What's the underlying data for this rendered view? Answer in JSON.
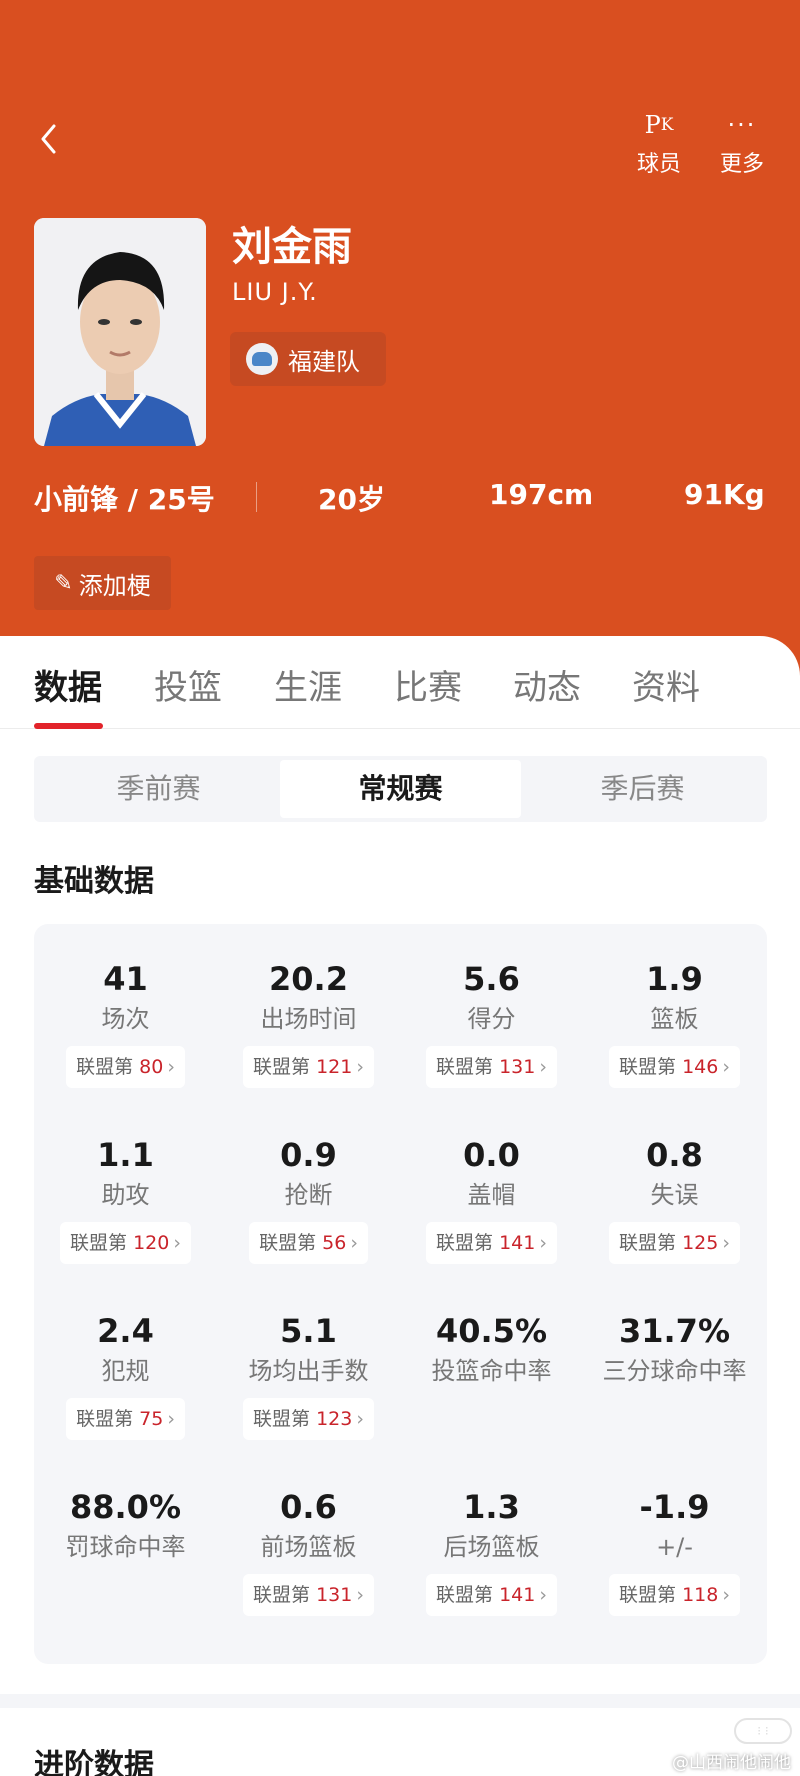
{
  "header": {
    "pk_label": "球员",
    "more_label": "更多",
    "player_name": "刘金雨",
    "player_name_en": "LIU J.Y.",
    "team": "福建队",
    "position_number": "小前锋 / 25号",
    "age": "20岁",
    "height": "197cm",
    "weight": "91Kg",
    "add_tag_label": "添加梗",
    "background_color": "#d94f20"
  },
  "tabs": [
    {
      "label": "数据",
      "active": true
    },
    {
      "label": "投篮",
      "active": false
    },
    {
      "label": "生涯",
      "active": false
    },
    {
      "label": "比赛",
      "active": false
    },
    {
      "label": "动态",
      "active": false
    },
    {
      "label": "资料",
      "active": false
    }
  ],
  "season_types": [
    {
      "label": "季前赛",
      "active": false
    },
    {
      "label": "常规赛",
      "active": true
    },
    {
      "label": "季后赛",
      "active": false
    }
  ],
  "basic_title": "基础数据",
  "advanced_title": "进阶数据",
  "rank_prefix": "联盟第",
  "basic_stats": [
    {
      "value": "41",
      "label": "场次",
      "rank": "80"
    },
    {
      "value": "20.2",
      "label": "出场时间",
      "rank": "121"
    },
    {
      "value": "5.6",
      "label": "得分",
      "rank": "131"
    },
    {
      "value": "1.9",
      "label": "篮板",
      "rank": "146"
    },
    {
      "value": "1.1",
      "label": "助攻",
      "rank": "120"
    },
    {
      "value": "0.9",
      "label": "抢断",
      "rank": "56"
    },
    {
      "value": "0.0",
      "label": "盖帽",
      "rank": "141"
    },
    {
      "value": "0.8",
      "label": "失误",
      "rank": "125"
    },
    {
      "value": "2.4",
      "label": "犯规",
      "rank": "75"
    },
    {
      "value": "5.1",
      "label": "场均出手数",
      "rank": "123"
    },
    {
      "value": "40.5%",
      "label": "投篮命中率",
      "rank": null
    },
    {
      "value": "31.7%",
      "label": "三分球命中率",
      "rank": null
    },
    {
      "value": "88.0%",
      "label": "罚球命中率",
      "rank": null
    },
    {
      "value": "0.6",
      "label": "前场篮板",
      "rank": "131"
    },
    {
      "value": "1.3",
      "label": "后场篮板",
      "rank": "141"
    },
    {
      "value": "-1.9",
      "label": "+/-",
      "rank": "118"
    }
  ],
  "watermark": "@山西闹他闹他",
  "accent_color": "#e2232a",
  "rank_color": "#c9242b"
}
